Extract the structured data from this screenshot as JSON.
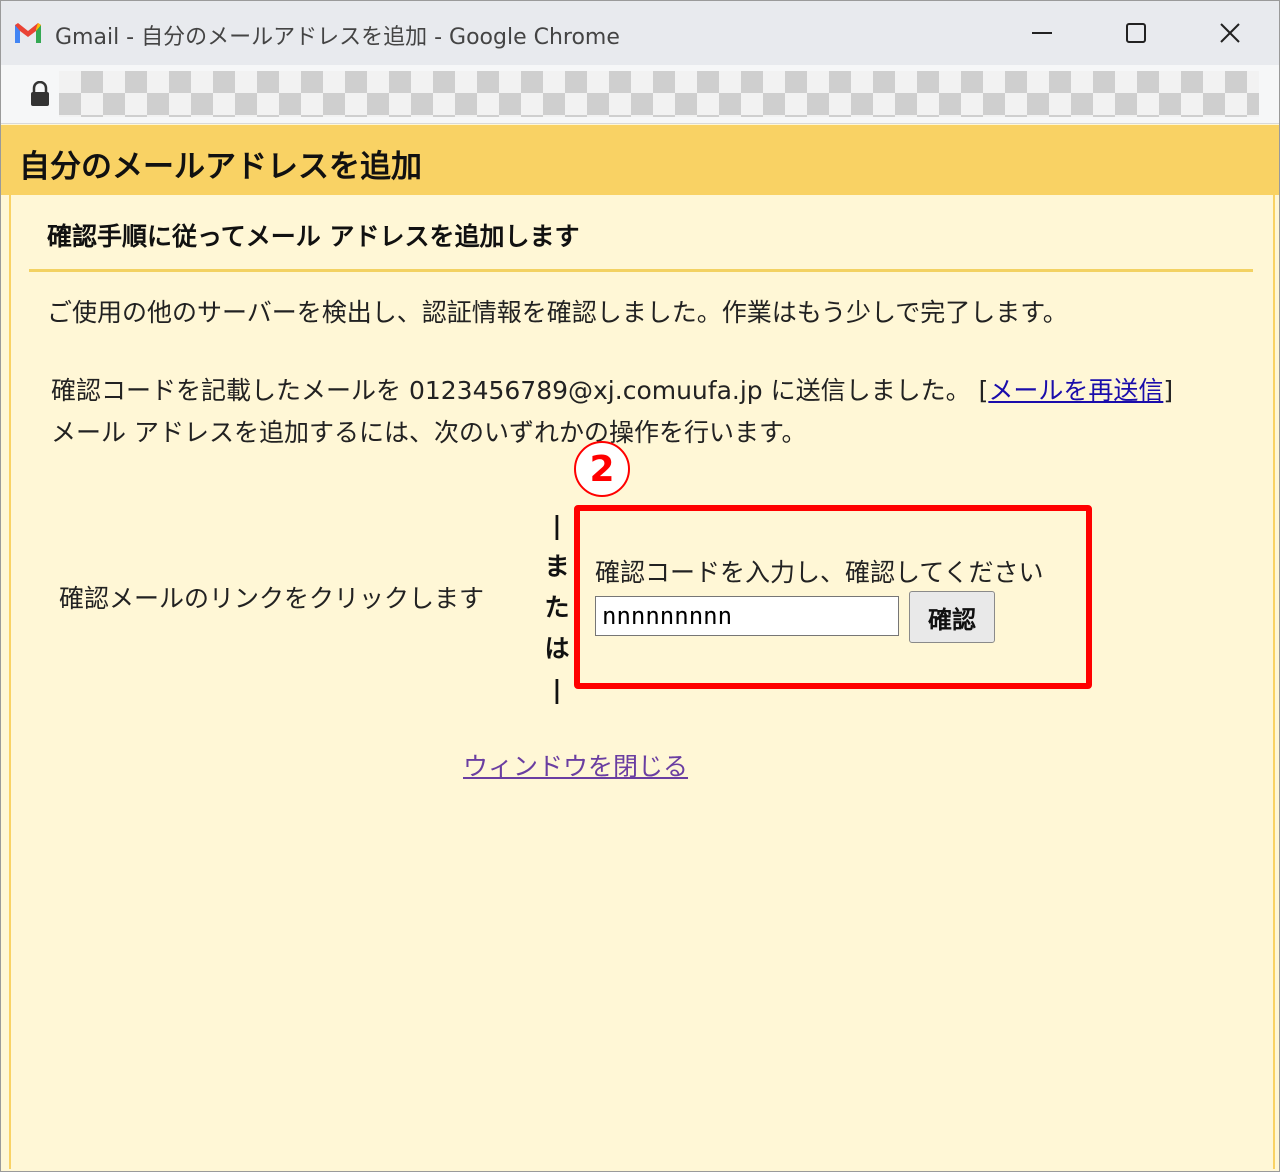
{
  "window": {
    "title": "Gmail - 自分のメールアドレスを追加 - Google Chrome",
    "controls": {
      "minimize_icon": "minimize-icon",
      "maximize_icon": "maximize-icon",
      "close_icon": "close-icon"
    }
  },
  "addressbar": {
    "lock_icon": "lock-icon",
    "url": ""
  },
  "page": {
    "title": "自分のメールアドレスを追加",
    "subtitle": "確認手順に従ってメール アドレスを追加します",
    "message1": "ご使用の他のサーバーを検出し、認証情報を確認しました。作業はもう少しで完了します。",
    "message2_prefix": "確認コードを記載したメールを 0123456789@xj.comuufa.jp に送信しました。 ",
    "resend_bracket_open": "[",
    "resend_link": "メールを再送信",
    "resend_bracket_close": "]",
    "message3": "メール アドレスを追加するには、次のいずれかの操作を行います。",
    "option_click_link": "確認メールのリンクをクリックします",
    "or_chars": [
      "|",
      "ま",
      "た",
      "は",
      "|"
    ],
    "code_prompt": "確認コードを入力し、確認してください",
    "code_value": "nnnnnnnnn",
    "confirm_button": "確認",
    "close_window_link": "ウィンドウを閉じる"
  },
  "annotation": {
    "step_number": "2",
    "color": "#ff0000"
  },
  "colors": {
    "header_bg": "#f9d264",
    "content_bg": "#fff7d6",
    "link": "#1a0dab",
    "visited_link": "#6a3ea1"
  }
}
